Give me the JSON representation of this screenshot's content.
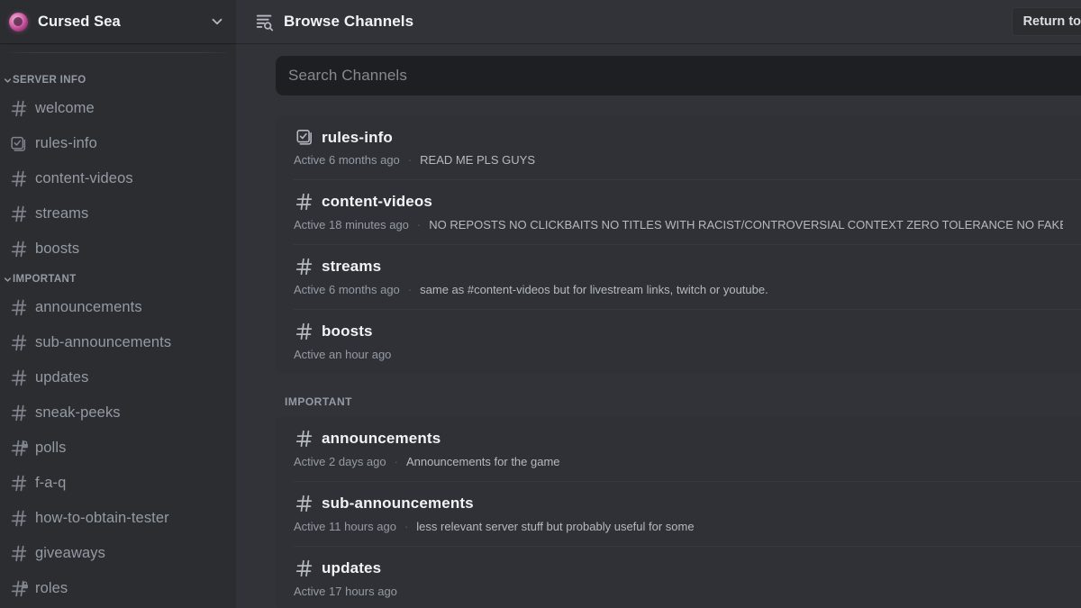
{
  "sidebar": {
    "server": {
      "name": "Cursed Sea",
      "icon": "server-avatar",
      "dropdown_icon": "chevron-down-icon"
    },
    "categories": [
      {
        "label": "SERVER INFO",
        "channels": [
          {
            "name": "welcome",
            "icon": "hash-icon",
            "private": false
          },
          {
            "name": "rules-info",
            "icon": "rules-icon",
            "private": false
          },
          {
            "name": "content-videos",
            "icon": "hash-icon",
            "private": false
          },
          {
            "name": "streams",
            "icon": "hash-icon",
            "private": false
          },
          {
            "name": "boosts",
            "icon": "hash-icon",
            "private": false
          }
        ]
      },
      {
        "label": "IMPORTANT",
        "channels": [
          {
            "name": "announcements",
            "icon": "hash-icon",
            "private": false
          },
          {
            "name": "sub-announcements",
            "icon": "hash-icon",
            "private": false
          },
          {
            "name": "updates",
            "icon": "hash-icon",
            "private": false
          },
          {
            "name": "sneak-peeks",
            "icon": "hash-icon",
            "private": false
          },
          {
            "name": "polls",
            "icon": "hash-lock-icon",
            "private": true
          },
          {
            "name": "f-a-q",
            "icon": "hash-icon",
            "private": false
          },
          {
            "name": "how-to-obtain-tester",
            "icon": "hash-icon",
            "private": false
          },
          {
            "name": "giveaways",
            "icon": "hash-icon",
            "private": false
          },
          {
            "name": "roles",
            "icon": "hash-lock-icon",
            "private": true
          }
        ]
      }
    ]
  },
  "topbar": {
    "icon": "browse-channels-icon",
    "title": "Browse Channels",
    "return_button": {
      "label": "Return to",
      "icon": "hash-icon"
    }
  },
  "search": {
    "placeholder": "Search Channels",
    "value": ""
  },
  "browse": {
    "groups": [
      {
        "label": "",
        "channels": [
          {
            "name": "rules-info",
            "icon": "rules-icon",
            "active": "Active 6 months ago",
            "topic": "READ ME PLS GUYS"
          },
          {
            "name": "content-videos",
            "icon": "hash-icon",
            "active": "Active 18 minutes ago",
            "topic": "NO REPOSTS NO CLICKBAITS NO TITLES WITH RACIST/CONTROVERSIAL CONTEXT ZERO TOLERANCE NO FAKE LEAKS"
          },
          {
            "name": "streams",
            "icon": "hash-icon",
            "active": "Active 6 months ago",
            "topic": "same as #content-videos but for livestream links, twitch or youtube."
          },
          {
            "name": "boosts",
            "icon": "hash-icon",
            "active": "Active an hour ago",
            "topic": ""
          }
        ]
      },
      {
        "label": "IMPORTANT",
        "channels": [
          {
            "name": "announcements",
            "icon": "hash-icon",
            "active": "Active 2 days ago",
            "topic": "Announcements for the game"
          },
          {
            "name": "sub-announcements",
            "icon": "hash-icon",
            "active": "Active 11 hours ago",
            "topic": "less relevant server stuff but probably useful for some"
          },
          {
            "name": "updates",
            "icon": "hash-icon",
            "active": "Active 17 hours ago",
            "topic": ""
          }
        ]
      }
    ]
  },
  "colors": {
    "sidebar_bg": "#2b2d31",
    "main_bg": "#313338",
    "card_bg": "#2f3136",
    "search_bg": "#1e1f22",
    "text_primary": "#f2f3f5",
    "text_muted": "#949ba4",
    "text_secondary": "#b5bac1",
    "server_accent": "#d96fb0"
  }
}
